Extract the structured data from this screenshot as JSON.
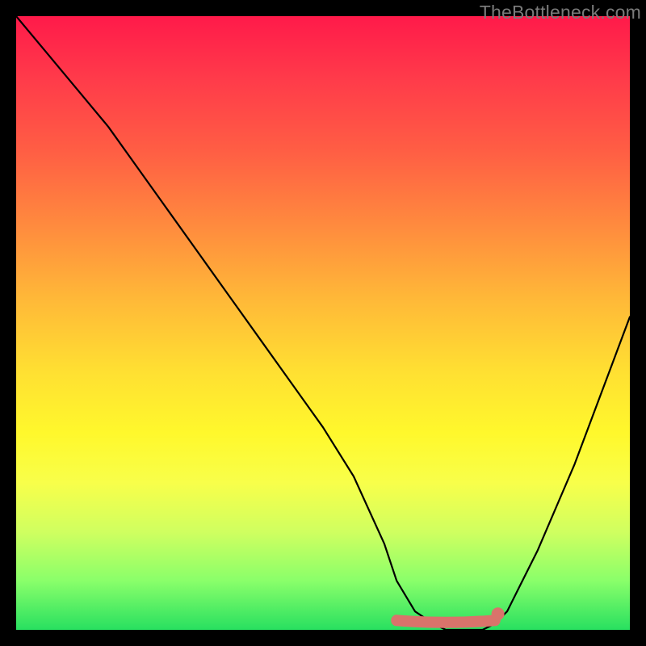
{
  "watermark": "TheBottleneck.com",
  "chart_data": {
    "type": "line",
    "title": "",
    "xlabel": "",
    "ylabel": "",
    "xlim": [
      0,
      100
    ],
    "ylim": [
      0,
      100
    ],
    "series": [
      {
        "name": "bottleneck-curve",
        "x": [
          0,
          5,
          10,
          15,
          20,
          25,
          30,
          35,
          40,
          45,
          50,
          55,
          60,
          62,
          65,
          68,
          70,
          72,
          74,
          76,
          78,
          80,
          82,
          85,
          88,
          91,
          94,
          97,
          100
        ],
        "values": [
          100,
          94,
          88,
          82,
          75,
          68,
          61,
          54,
          47,
          40,
          33,
          25,
          14,
          8,
          3,
          1,
          0,
          0,
          0,
          0,
          1,
          3,
          7,
          13,
          20,
          27,
          35,
          43,
          51
        ]
      }
    ],
    "marker": {
      "name": "sweet-spot-band",
      "x_start": 62,
      "x_end": 78,
      "y": 1.8,
      "color": "#d9736b"
    },
    "marker_dot": {
      "x": 78.5,
      "y": 2.6,
      "color": "#d9736b"
    },
    "background": {
      "style": "vertical-gradient",
      "stops": [
        {
          "pos": 0,
          "color": "#ff1a4a"
        },
        {
          "pos": 50,
          "color": "#ffd332"
        },
        {
          "pos": 100,
          "color": "#28e060"
        }
      ]
    }
  }
}
